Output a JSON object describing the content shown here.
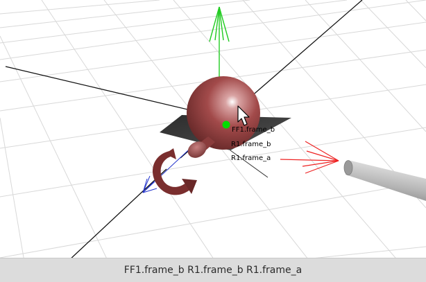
{
  "viewport": {
    "frame_labels": {
      "ff1_frame_b": "FF1.frame_b",
      "r1_frame_b": "R1.frame_b",
      "r1_frame_a": "R1.frame_a"
    },
    "colors": {
      "background": "#ffffff",
      "grid_line": "#dcdcdc",
      "world_axis": "#111111",
      "y_axis_arrow": "#22cc22",
      "x_axis_arrow": "#ee2222",
      "z_axis_arrow": "#2233cc",
      "sphere": "#a04848",
      "plate": "#404040",
      "cylinder": "#9a9a9a",
      "pivot_dot": "#00dd00"
    },
    "icons": [
      "mouse-pointer-icon"
    ]
  },
  "status_bar": {
    "text": "FF1.frame_b R1.frame_b R1.frame_a"
  }
}
